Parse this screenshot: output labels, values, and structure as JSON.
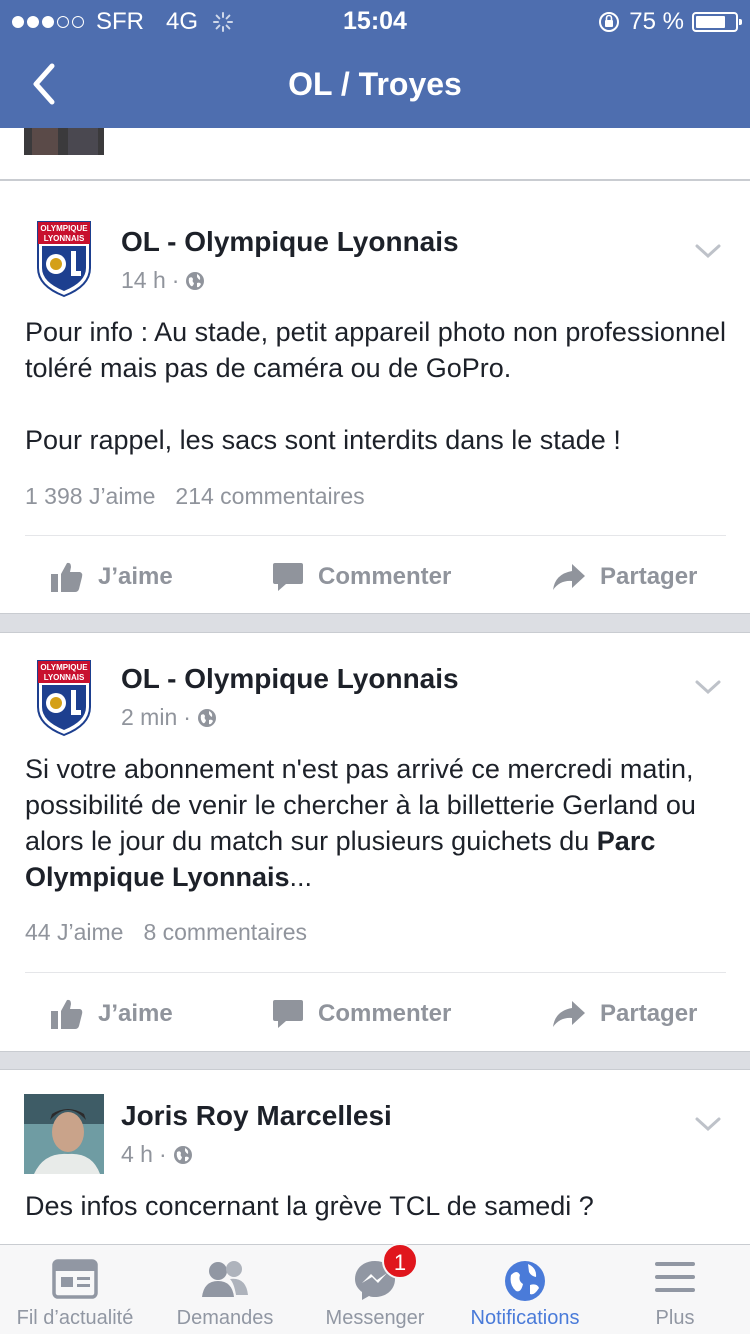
{
  "status_bar": {
    "carrier": "SFR",
    "network": "4G",
    "time": "15:04",
    "battery_percent": "75 %",
    "battery_level": 0.75,
    "signal_bars": 3
  },
  "nav": {
    "title": "OL / Troyes",
    "back_icon": "chevron-left-icon"
  },
  "posts": [
    {
      "author": "OL - Olympique Lyonnais",
      "time": "14 h",
      "separator": "·",
      "privacy_icon": "globe-icon",
      "body": "Pour info : Au stade, petit appareil photo non professionnel toléré mais pas de caméra ou de GoPro.\n\nPour rappel, les sacs sont interdits dans le stade !",
      "likes": "1 398 J’aime",
      "comments": "214 commentaires"
    },
    {
      "author": "OL - Olympique Lyonnais",
      "time": "2 min",
      "separator": "·",
      "privacy_icon": "globe-icon",
      "body_before": "Si votre abonnement n'est pas arrivé ce mercredi matin, possibilité de venir le chercher à la billetterie Gerland ou alors le jour du match sur plusieurs guichets du ",
      "body_bold": "Parc Olympique Lyonnais",
      "body_after": "...",
      "likes": "44 J’aime",
      "comments": "8 commentaires"
    },
    {
      "author": "Joris Roy Marcellesi",
      "time": "4 h",
      "separator": "·",
      "privacy_icon": "globe-icon",
      "body": "Des infos concernant la grève TCL de samedi ?"
    }
  ],
  "logo_text": [
    "OLYMPIQUE",
    "LYONNAIS"
  ],
  "actions": {
    "like": "J’aime",
    "comment": "Commenter",
    "share": "Partager"
  },
  "tabs": [
    {
      "label": "Fil d’actualité",
      "icon": "news-feed-icon"
    },
    {
      "label": "Demandes",
      "icon": "friend-requests-icon"
    },
    {
      "label": "Messenger",
      "icon": "messenger-icon",
      "badge": "1"
    },
    {
      "label": "Notifications",
      "icon": "globe-icon",
      "active": true
    },
    {
      "label": "Plus",
      "icon": "menu-icon"
    }
  ],
  "colors": {
    "header": "#4e6eaf",
    "active_tab": "#4a7bd9",
    "badge": "#e0161d",
    "ol_red": "#c8102e",
    "ol_blue": "#1d3f8f",
    "muted": "#90949c"
  }
}
